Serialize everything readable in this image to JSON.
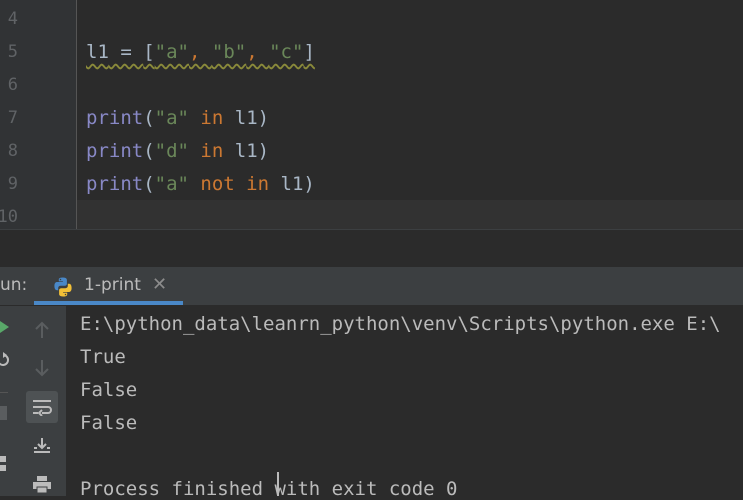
{
  "editor": {
    "line_numbers": [
      "4",
      "5",
      "6",
      "7",
      "8",
      "9",
      "10"
    ],
    "line5": {
      "var": "l1",
      "eq": " = ",
      "open": "[",
      "s1": "\"a\"",
      "c1": ", ",
      "s2": "\"b\"",
      "c2": ", ",
      "s3": "\"c\"",
      "close": "]"
    },
    "line7": {
      "fn": "print",
      "open": "(",
      "str": "\"a\"",
      "kw": " in ",
      "var": "l1",
      "close": ")"
    },
    "line8": {
      "fn": "print",
      "open": "(",
      "str": "\"d\"",
      "kw": " in ",
      "var": "l1",
      "close": ")"
    },
    "line9": {
      "fn": "print",
      "open": "(",
      "str": "\"a\"",
      "kw": " not in ",
      "var": "l1",
      "close": ")"
    }
  },
  "run": {
    "label": "un:",
    "tab_label": "1-print",
    "tab_close": "✕"
  },
  "console": {
    "lines": [
      "E:\\python_data\\leanrn_python\\venv\\Scripts\\python.exe E:\\",
      "True",
      "False",
      "False",
      "",
      "Process finished with exit code 0"
    ]
  },
  "icons": {
    "rerun": "play-icon",
    "stop": "stop-icon",
    "wrap": "soft-wrap-icon",
    "scroll": "scroll-to-end-icon",
    "print": "print-icon"
  }
}
